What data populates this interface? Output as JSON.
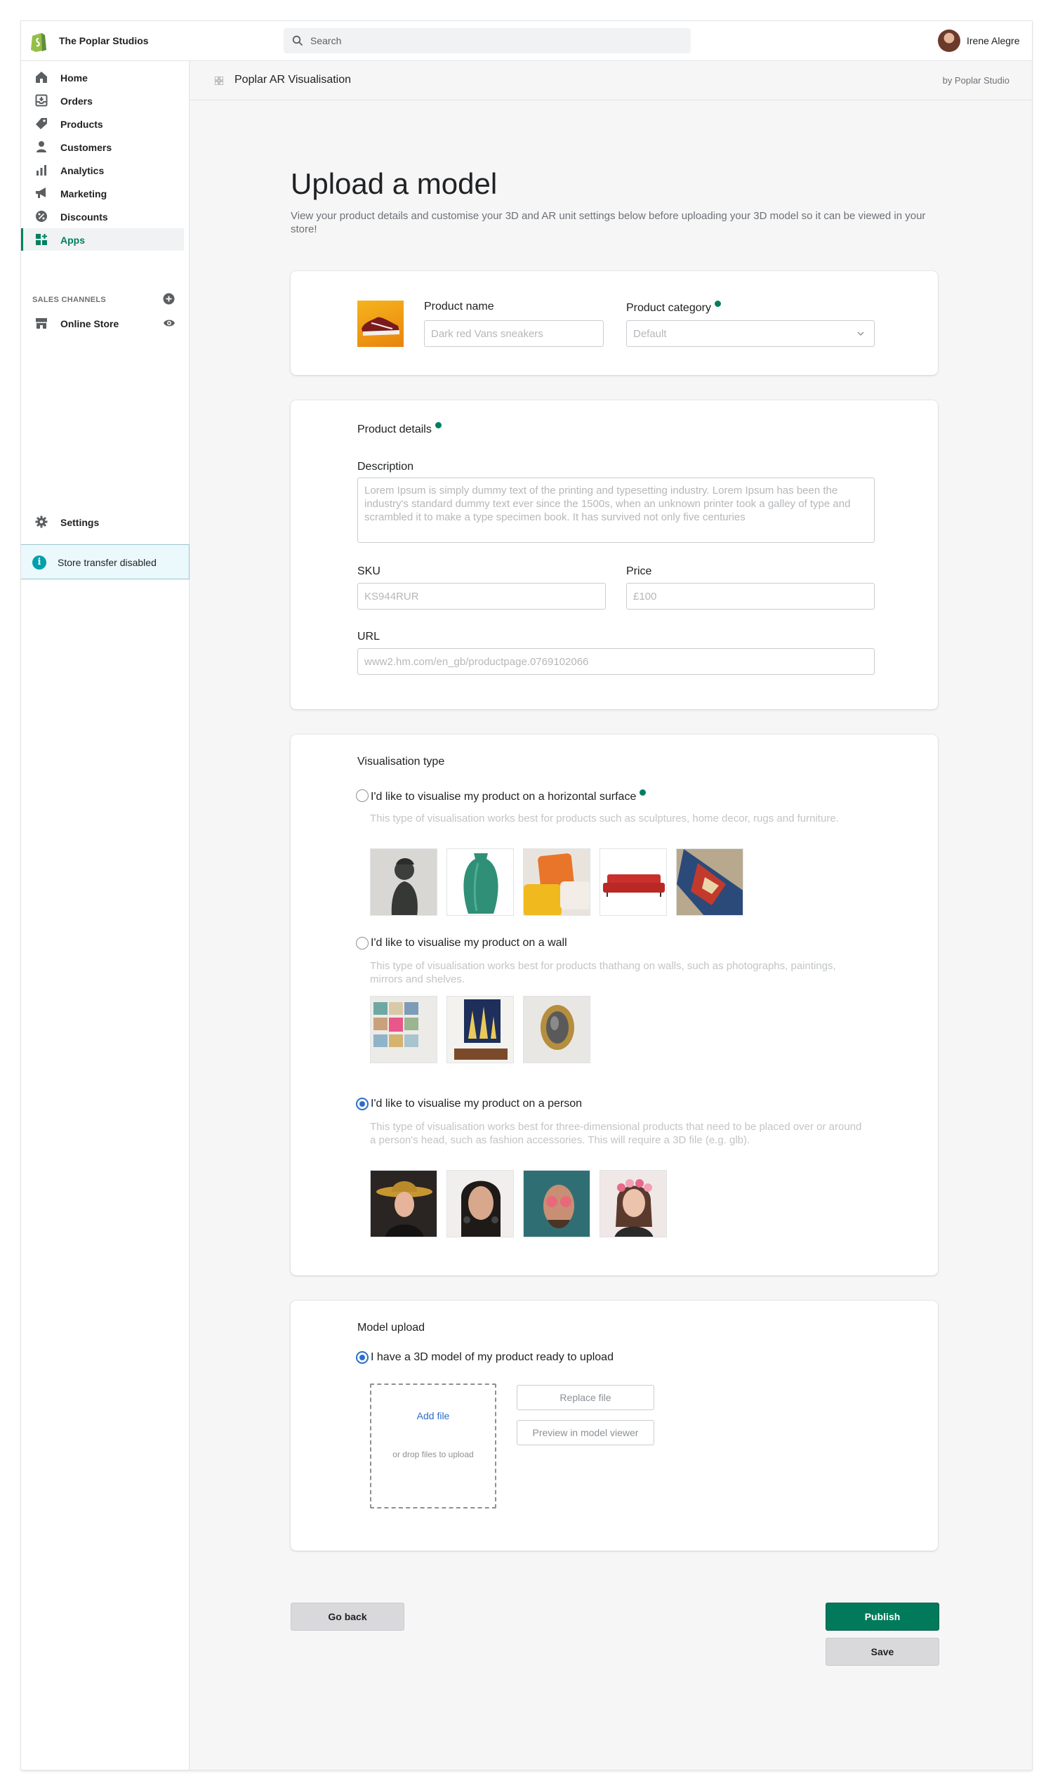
{
  "topbar": {
    "store_name": "The Poplar Studios",
    "search_placeholder": "Search",
    "user_name": "Irene Alegre"
  },
  "sidebar": {
    "items": [
      {
        "label": "Home",
        "icon": "home-icon"
      },
      {
        "label": "Orders",
        "icon": "orders-icon"
      },
      {
        "label": "Products",
        "icon": "tag-icon"
      },
      {
        "label": "Customers",
        "icon": "person-icon"
      },
      {
        "label": "Analytics",
        "icon": "bar-chart-icon"
      },
      {
        "label": "Marketing",
        "icon": "megaphone-icon"
      },
      {
        "label": "Discounts",
        "icon": "discount-icon"
      },
      {
        "label": "Apps",
        "icon": "apps-icon"
      }
    ],
    "sales_channels_label": "SALES CHANNELS",
    "online_store": "Online Store",
    "settings": "Settings",
    "store_transfer": "Store transfer disabled"
  },
  "appbar": {
    "title": "Poplar AR Visualisation",
    "by": "by Poplar Studio"
  },
  "page": {
    "title": "Upload a model",
    "subtitle": "View your product details and customise your 3D and AR unit settings below before uploading your 3D model so it can be viewed in your store!"
  },
  "product": {
    "name_label": "Product name",
    "name_placeholder": "Dark red Vans sneakers",
    "category_label": "Product category",
    "category_value": "Default"
  },
  "details": {
    "title": "Product details",
    "description_label": "Description",
    "description_placeholder": "Lorem Ipsum is simply dummy text of the printing and typesetting industry. Lorem Ipsum has been the industry's standard dummy text ever since the 1500s, when an unknown printer took a galley of type and scrambled it to make a type specimen book. It has survived not only five centuries",
    "sku_label": "SKU",
    "sku_placeholder": "KS944RUR",
    "price_label": "Price",
    "price_placeholder": "£100",
    "url_label": "URL",
    "url_placeholder": "www2.hm.com/en_gb/productpage.0769102066"
  },
  "visualisation": {
    "title": "Visualisation type",
    "options": [
      {
        "label": "I'd like to visualise my product on a horizontal surface",
        "hint": "This type of visualisation works best for products such as sculptures, home decor, rugs and furniture.",
        "selected": false
      },
      {
        "label": "I'd like to visualise my product on a wall",
        "hint": "This type of visualisation works best for products thathang on walls, such as photographs, paintings, mirrors and shelves.",
        "selected": false
      },
      {
        "label": "I'd like to visualise my product on a person",
        "hint": "This type of visualisation works best for three-dimensional products that need to be placed over or around a person's head, such as fashion accessories. This will require a 3D file (e.g. glb).",
        "selected": true
      }
    ]
  },
  "upload": {
    "title": "Model upload",
    "option_label": "I have a 3D model of my product ready to upload",
    "add_file": "Add file",
    "drop_hint": "or drop files to upload",
    "replace": "Replace file",
    "preview": "Preview in model viewer"
  },
  "actions": {
    "back": "Go back",
    "publish": "Publish",
    "save": "Save"
  },
  "colors": {
    "brand_green": "#008060",
    "publish_green": "#007a5a",
    "radio_blue": "#2c6ecb",
    "link_blue": "#2c6ecb"
  }
}
